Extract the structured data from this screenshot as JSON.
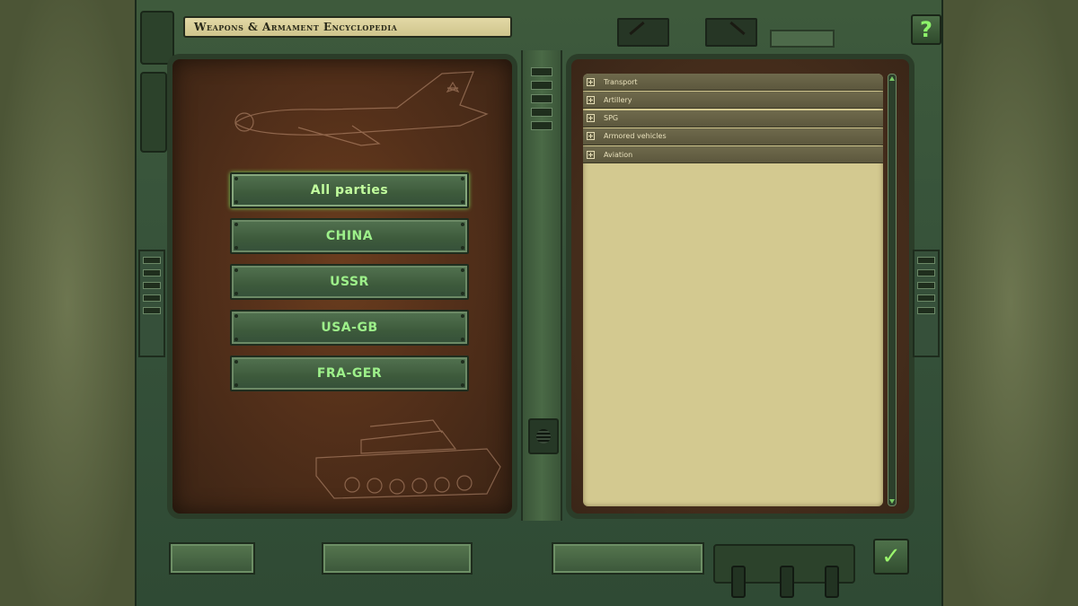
{
  "window": {
    "title": "Weapons & Armament Encyclopedia"
  },
  "help": {
    "label": "?"
  },
  "parties": [
    {
      "label": "All parties",
      "selected": true
    },
    {
      "label": "CHINA",
      "selected": false
    },
    {
      "label": "USSR",
      "selected": false
    },
    {
      "label": "USA-GB",
      "selected": false
    },
    {
      "label": "FRA-GER",
      "selected": false
    }
  ],
  "categories": [
    {
      "label": "Transport"
    },
    {
      "label": "Artillery"
    },
    {
      "label": "SPG"
    },
    {
      "label": "Armored vehicles"
    },
    {
      "label": "Aviation"
    }
  ],
  "ok": {
    "label": "✓"
  },
  "colors": {
    "accent": "#9df08a",
    "frame": "#3e5a3c",
    "parchment": "#d3c990",
    "leather": "#54301a"
  },
  "icons": {
    "help": "question-icon",
    "ok": "checkmark-icon",
    "expand": "plus-icon"
  }
}
